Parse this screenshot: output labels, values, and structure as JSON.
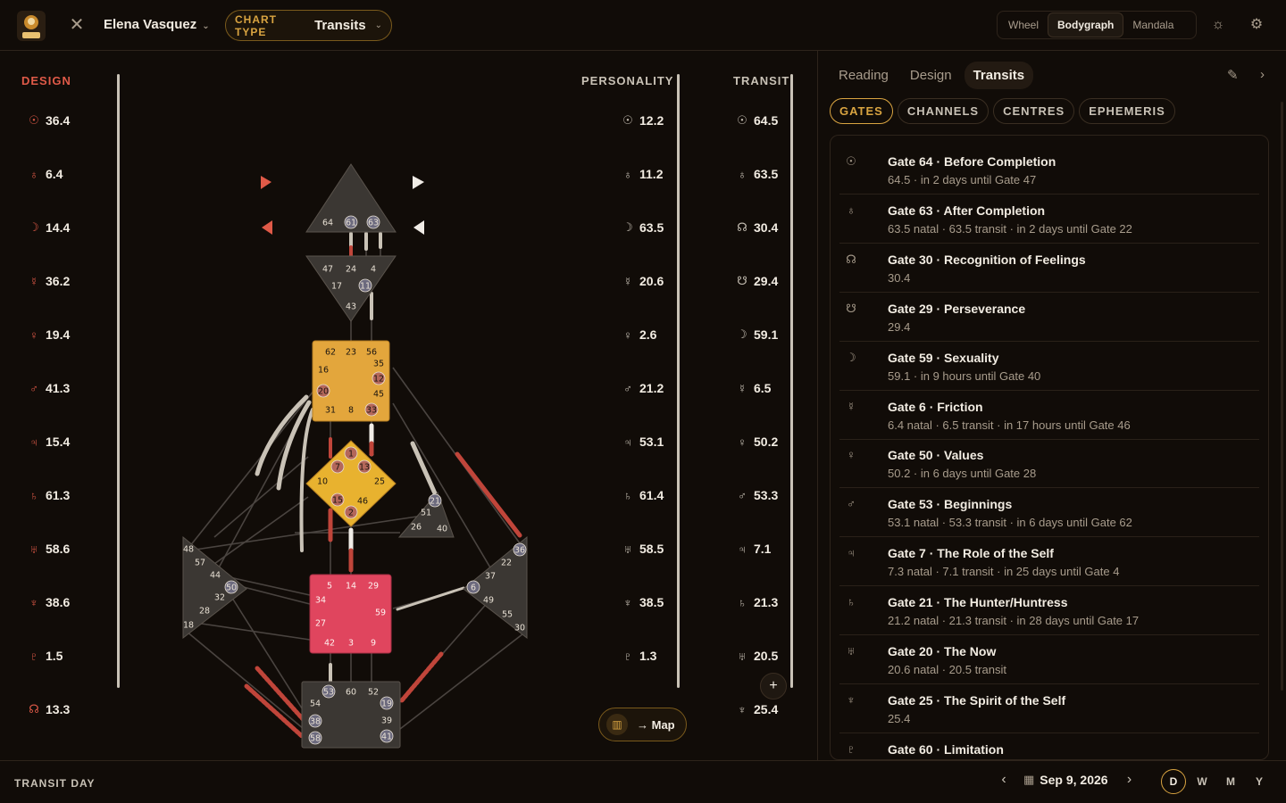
{
  "header": {
    "user_name": "Elena Vasquez",
    "chart_type_label": "CHART TYPE",
    "chart_type_value": "Transits",
    "views": [
      "Wheel",
      "Bodygraph",
      "Mandala"
    ],
    "active_view": "Bodygraph"
  },
  "columns": {
    "design_title": "DESIGN",
    "personality_title": "PERSONALITY",
    "transit_title": "TRANSIT"
  },
  "design": [
    {
      "g": "☉",
      "v": "36.4"
    },
    {
      "g": "♁",
      "v": "6.4"
    },
    {
      "g": "☽",
      "v": "14.4"
    },
    {
      "g": "☿",
      "v": "36.2"
    },
    {
      "g": "♀",
      "v": "19.4"
    },
    {
      "g": "♂",
      "v": "41.3"
    },
    {
      "g": "♃",
      "v": "15.4"
    },
    {
      "g": "♄",
      "v": "61.3"
    },
    {
      "g": "♅",
      "v": "58.6"
    },
    {
      "g": "♆",
      "v": "38.6"
    },
    {
      "g": "♇",
      "v": "1.5"
    },
    {
      "g": "☊",
      "v": "13.3"
    }
  ],
  "personality": [
    {
      "g": "☉",
      "v": "12.2"
    },
    {
      "g": "♁",
      "v": "11.2"
    },
    {
      "g": "☽",
      "v": "63.5"
    },
    {
      "g": "☿",
      "v": "20.6"
    },
    {
      "g": "♀",
      "v": "2.6"
    },
    {
      "g": "♂",
      "v": "21.2"
    },
    {
      "g": "♃",
      "v": "53.1"
    },
    {
      "g": "♄",
      "v": "61.4"
    },
    {
      "g": "♅",
      "v": "58.5"
    },
    {
      "g": "♆",
      "v": "38.5"
    },
    {
      "g": "♇",
      "v": "1.3"
    }
  ],
  "transit": [
    {
      "g": "☉",
      "v": "64.5"
    },
    {
      "g": "♁",
      "v": "63.5"
    },
    {
      "g": "☊",
      "v": "30.4"
    },
    {
      "g": "☋",
      "v": "29.4"
    },
    {
      "g": "☽",
      "v": "59.1"
    },
    {
      "g": "☿",
      "v": "6.5"
    },
    {
      "g": "♀",
      "v": "50.2"
    },
    {
      "g": "♂",
      "v": "53.3"
    },
    {
      "g": "♃",
      "v": "7.1"
    },
    {
      "g": "♄",
      "v": "21.3"
    },
    {
      "g": "♅",
      "v": "20.5"
    },
    {
      "g": "♆",
      "v": "25.4"
    }
  ],
  "map_button": "→ Map",
  "plus_button": "+",
  "right_panel": {
    "tabs": [
      "Reading",
      "Design",
      "Transits"
    ],
    "active_tab": "Transits",
    "pills": [
      "GATES",
      "CHANNELS",
      "CENTRES",
      "EPHEMERIS"
    ],
    "active_pill": "GATES",
    "gates": [
      {
        "g": "☉",
        "t": "Gate 64 · Before Completion",
        "s": "64.5 · in 2 days until Gate 47"
      },
      {
        "g": "♁",
        "t": "Gate 63 · After Completion",
        "s": "63.5 natal · 63.5 transit · in 2 days until Gate 22"
      },
      {
        "g": "☊",
        "t": "Gate 30 · Recognition of Feelings",
        "s": "30.4"
      },
      {
        "g": "☋",
        "t": "Gate 29 · Perseverance",
        "s": "29.4"
      },
      {
        "g": "☽",
        "t": "Gate 59 · Sexuality",
        "s": "59.1 · in 9 hours until Gate 40"
      },
      {
        "g": "☿",
        "t": "Gate 6 · Friction",
        "s": "6.4 natal · 6.5 transit · in 17 hours until Gate 46"
      },
      {
        "g": "♀",
        "t": "Gate 50 · Values",
        "s": "50.2 · in 6 days until Gate 28"
      },
      {
        "g": "♂",
        "t": "Gate 53 · Beginnings",
        "s": "53.1 natal · 53.3 transit · in 6 days until Gate 62"
      },
      {
        "g": "♃",
        "t": "Gate 7 · The Role of the Self",
        "s": "7.3 natal · 7.1 transit · in 25 days until Gate 4"
      },
      {
        "g": "♄",
        "t": "Gate 21 · The Hunter/Huntress",
        "s": "21.2 natal · 21.3 transit · in 28 days until Gate 17"
      },
      {
        "g": "♅",
        "t": "Gate 20 · The Now",
        "s": "20.6 natal · 20.5 transit"
      },
      {
        "g": "♆",
        "t": "Gate 25 · The Spirit of the Self",
        "s": "25.4"
      },
      {
        "g": "♇",
        "t": "Gate 60 · Limitation",
        "s": ""
      }
    ]
  },
  "footer": {
    "label": "TRANSIT DAY",
    "date": "Sep 9, 2026",
    "ranges": [
      "D",
      "W",
      "M",
      "Y"
    ],
    "active_range": "D"
  },
  "centres": {
    "head": [
      "64",
      "61",
      "63"
    ],
    "ajna": [
      "47",
      "24",
      "4",
      "17",
      "11",
      "43"
    ],
    "throat": [
      "62",
      "23",
      "56",
      "16",
      "35",
      "12",
      "20",
      "45",
      "31",
      "8",
      "33"
    ],
    "g": [
      "1",
      "7",
      "13",
      "10",
      "25",
      "15",
      "46",
      "2"
    ],
    "ego": [
      "21",
      "51",
      "26",
      "40"
    ],
    "spleen": [
      "48",
      "57",
      "44",
      "50",
      "32",
      "28",
      "18"
    ],
    "sacral": [
      "5",
      "14",
      "29",
      "34",
      "59",
      "27",
      "42",
      "3",
      "9"
    ],
    "solar": [
      "36",
      "22",
      "37",
      "6",
      "49",
      "55",
      "30"
    ],
    "root": [
      "53",
      "60",
      "52",
      "54",
      "19",
      "38",
      "39",
      "58",
      "41"
    ]
  },
  "colors": {
    "accent": "#d9a441",
    "design_red": "#e05a48",
    "throat_fill": "#e3a63c",
    "g_fill": "#e8b22f",
    "sacral_fill": "#e0455e",
    "undefined_fill": "#3b3733"
  }
}
